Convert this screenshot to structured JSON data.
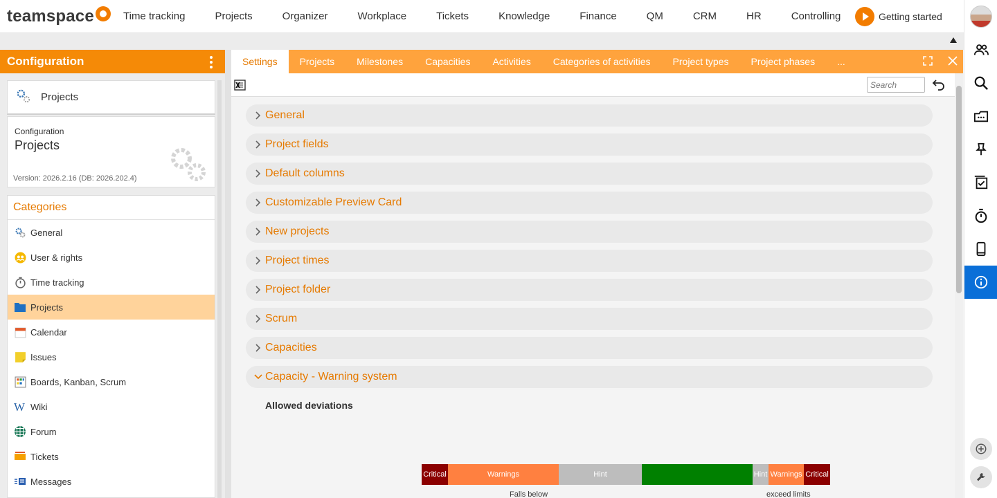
{
  "app": {
    "logo_text": "teamspace"
  },
  "topnav": [
    "Time tracking",
    "Projects",
    "Organizer",
    "Workplace",
    "Tickets",
    "Knowledge",
    "Finance",
    "QM",
    "CRM",
    "HR",
    "Controlling"
  ],
  "getting_started": "Getting started",
  "left": {
    "header": "Configuration",
    "module_title": "Projects",
    "info": {
      "label": "Configuration",
      "title": "Projects",
      "version": "Version: 2026.2.16 (DB: 2026.202.4)"
    },
    "categories_title": "Categories",
    "categories": [
      {
        "label": "General",
        "icon": "gear-icon"
      },
      {
        "label": "User & rights",
        "icon": "users-icon"
      },
      {
        "label": "Time tracking",
        "icon": "stopwatch-icon"
      },
      {
        "label": "Projects",
        "icon": "folder-icon",
        "active": true
      },
      {
        "label": "Calendar",
        "icon": "calendar-icon"
      },
      {
        "label": "Issues",
        "icon": "sticky-note-icon"
      },
      {
        "label": "Boards, Kanban, Scrum",
        "icon": "board-icon"
      },
      {
        "label": "Wiki",
        "icon": "wiki-icon"
      },
      {
        "label": "Forum",
        "icon": "forum-icon"
      },
      {
        "label": "Tickets",
        "icon": "ticket-icon"
      },
      {
        "label": "Messages",
        "icon": "messages-icon"
      }
    ]
  },
  "tabs": [
    "Settings",
    "Projects",
    "Milestones",
    "Capacities",
    "Activities",
    "Categories of activities",
    "Project types",
    "Project phases",
    "..."
  ],
  "toolbar": {
    "search_placeholder": "Search"
  },
  "sections": [
    {
      "label": "General",
      "expanded": false
    },
    {
      "label": "Project fields",
      "expanded": false
    },
    {
      "label": "Default columns",
      "expanded": false
    },
    {
      "label": "Customizable Preview Card",
      "expanded": false
    },
    {
      "label": "New projects",
      "expanded": false
    },
    {
      "label": "Project times",
      "expanded": false
    },
    {
      "label": "Project folder",
      "expanded": false
    },
    {
      "label": "Scrum",
      "expanded": false
    },
    {
      "label": "Capacities",
      "expanded": false
    },
    {
      "label": "Capacity - Warning system",
      "expanded": true
    }
  ],
  "warning_system": {
    "title": "Allowed deviations",
    "segments": [
      {
        "label": "Critical",
        "color": "#8b0000"
      },
      {
        "label": "Warnings",
        "color": "#ff8040"
      },
      {
        "label": "Hint",
        "color": "#bdbdbd"
      },
      {
        "label": "",
        "color": "#008000"
      },
      {
        "label": "Hint",
        "color": "#bdbdbd"
      },
      {
        "label": "Warnings",
        "color": "#ff8040"
      },
      {
        "label": "Critical",
        "color": "#8b0000"
      }
    ],
    "falls_below": "Falls below",
    "exceed_limits": "exceed limits"
  },
  "colors": {
    "accent": "#f58a07",
    "tab_bar": "#ffa33d",
    "section_text": "#e67a00",
    "active_rail": "#0a6fd8"
  }
}
